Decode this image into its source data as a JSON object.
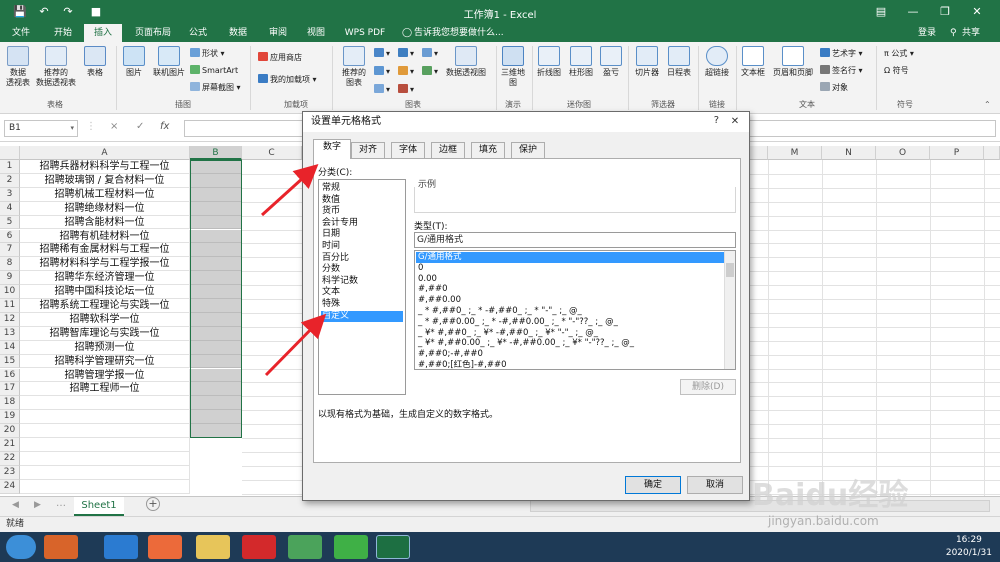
{
  "titlebar": {
    "title": "工作簿1 - Excel",
    "save_icon": "save-icon",
    "undo_icon": "undo-icon",
    "redo_icon": "redo-icon",
    "accent": "#217346"
  },
  "tabs": [
    "文件",
    "开始",
    "插入",
    "页面布局",
    "公式",
    "数据",
    "审阅",
    "视图",
    "WPS PDF"
  ],
  "active_tab": "插入",
  "tell_me": "告诉我您想要做什么...",
  "signin": "登录",
  "share": "共享",
  "ribbon": {
    "table_group": {
      "label": "表格",
      "pivot": "数据\n透视表",
      "rec_pivot": "推荐的\n数据透视表",
      "table": "表格"
    },
    "illus_group": {
      "label": "插图",
      "picture": "图片",
      "online_picture": "联机图片",
      "shapes": "形状",
      "smartart": "SmartArt",
      "screenshot": "屏幕截图"
    },
    "addins_group": {
      "label": "加载项",
      "store": "应用商店",
      "my_addins": "我的加载项"
    },
    "charts_group": {
      "label": "图表",
      "rec_charts": "推荐的\n图表",
      "pivot_chart": "数据透视图"
    },
    "tour_group": {
      "label": "演示",
      "map3d": "三维地\n图"
    },
    "spark_group": {
      "label": "迷你图",
      "line": "折线图",
      "column": "柱形图",
      "winloss": "盈亏"
    },
    "filter_group": {
      "label": "筛选器",
      "slicer": "切片器",
      "timeline": "日程表"
    },
    "links_group": {
      "label": "链接",
      "hyperlink": "超链接"
    },
    "text_group": {
      "label": "文本",
      "textbox": "文本框",
      "header_footer": "页眉和页脚",
      "wordart": "艺术字",
      "signature": "签名行",
      "object": "对象"
    },
    "symbols_group": {
      "label": "符号",
      "equation": "公式",
      "symbol": "符号"
    }
  },
  "formula_bar": {
    "name_box": "B1",
    "cancel": "×",
    "enter": "✓",
    "fx": "fx",
    "value": ""
  },
  "columns": [
    "A",
    "B",
    "C",
    "M",
    "N",
    "O",
    "P"
  ],
  "rows": [
    "1",
    "2",
    "3",
    "4",
    "5",
    "6",
    "7",
    "8",
    "9",
    "10",
    "11",
    "12",
    "13",
    "14",
    "15",
    "16",
    "17",
    "18",
    "19",
    "20",
    "21",
    "22",
    "23",
    "24"
  ],
  "column_a": [
    "招聘兵器材料科学与工程一位",
    "招聘玻璃钢 / 复合材料一位",
    "招聘机械工程材料一位",
    "招聘绝缘材料一位",
    "招聘含能材料一位",
    "招聘有机硅材料一位",
    "招聘稀有金属材料与工程一位",
    "招聘材料科学与工程学报一位",
    "招聘华东经济管理一位",
    "招聘中国科技论坛一位",
    "招聘系统工程理论与实践一位",
    "招聘软科学一位",
    "招聘智库理论与实践一位",
    "招聘预测一位",
    "招聘科学管理研究一位",
    "招聘管理学报一位",
    "招聘工程师一位"
  ],
  "sheet_tab": "Sheet1",
  "status": "就绪",
  "dialog": {
    "title": "设置单元格格式",
    "help": "?",
    "close": "✕",
    "tabs": [
      "数字",
      "对齐",
      "字体",
      "边框",
      "填充",
      "保护"
    ],
    "category_label": "分类(C):",
    "categories": [
      "常规",
      "数值",
      "货币",
      "会计专用",
      "日期",
      "时间",
      "百分比",
      "分数",
      "科学记数",
      "文本",
      "特殊",
      "自定义"
    ],
    "selected_category": "自定义",
    "sample_label": "示例",
    "type_label": "类型(T):",
    "type_value": "G/通用格式",
    "types": [
      "G/通用格式",
      "0",
      "0.00",
      "#,##0",
      "#,##0.00",
      "_ * #,##0_ ;_ * -#,##0_ ;_ * \"-\"_ ;_ @_",
      "_ * #,##0.00_ ;_ * -#,##0.00_ ;_ * \"-\"??_ ;_ @_",
      "_ ¥* #,##0_ ;_ ¥* -#,##0_ ;_ ¥* \"-\"_ ;_ @_",
      "_ ¥* #,##0.00_ ;_ ¥* -#,##0.00_ ;_ ¥* \"-\"??_ ;_ @_",
      "#,##0;-#,##0",
      "#,##0;[红色]-#,##0"
    ],
    "delete": "删除(D)",
    "note": "以现有格式为基础，生成自定义的数字格式。",
    "ok": "确定",
    "cancel": "取消"
  },
  "taskbar": {
    "time": "16:29",
    "date": "2020/1/31"
  },
  "watermark": {
    "main": "Baidu经验",
    "sub": "jingyan.baidu.com"
  },
  "annotation_color": "#e8232a"
}
